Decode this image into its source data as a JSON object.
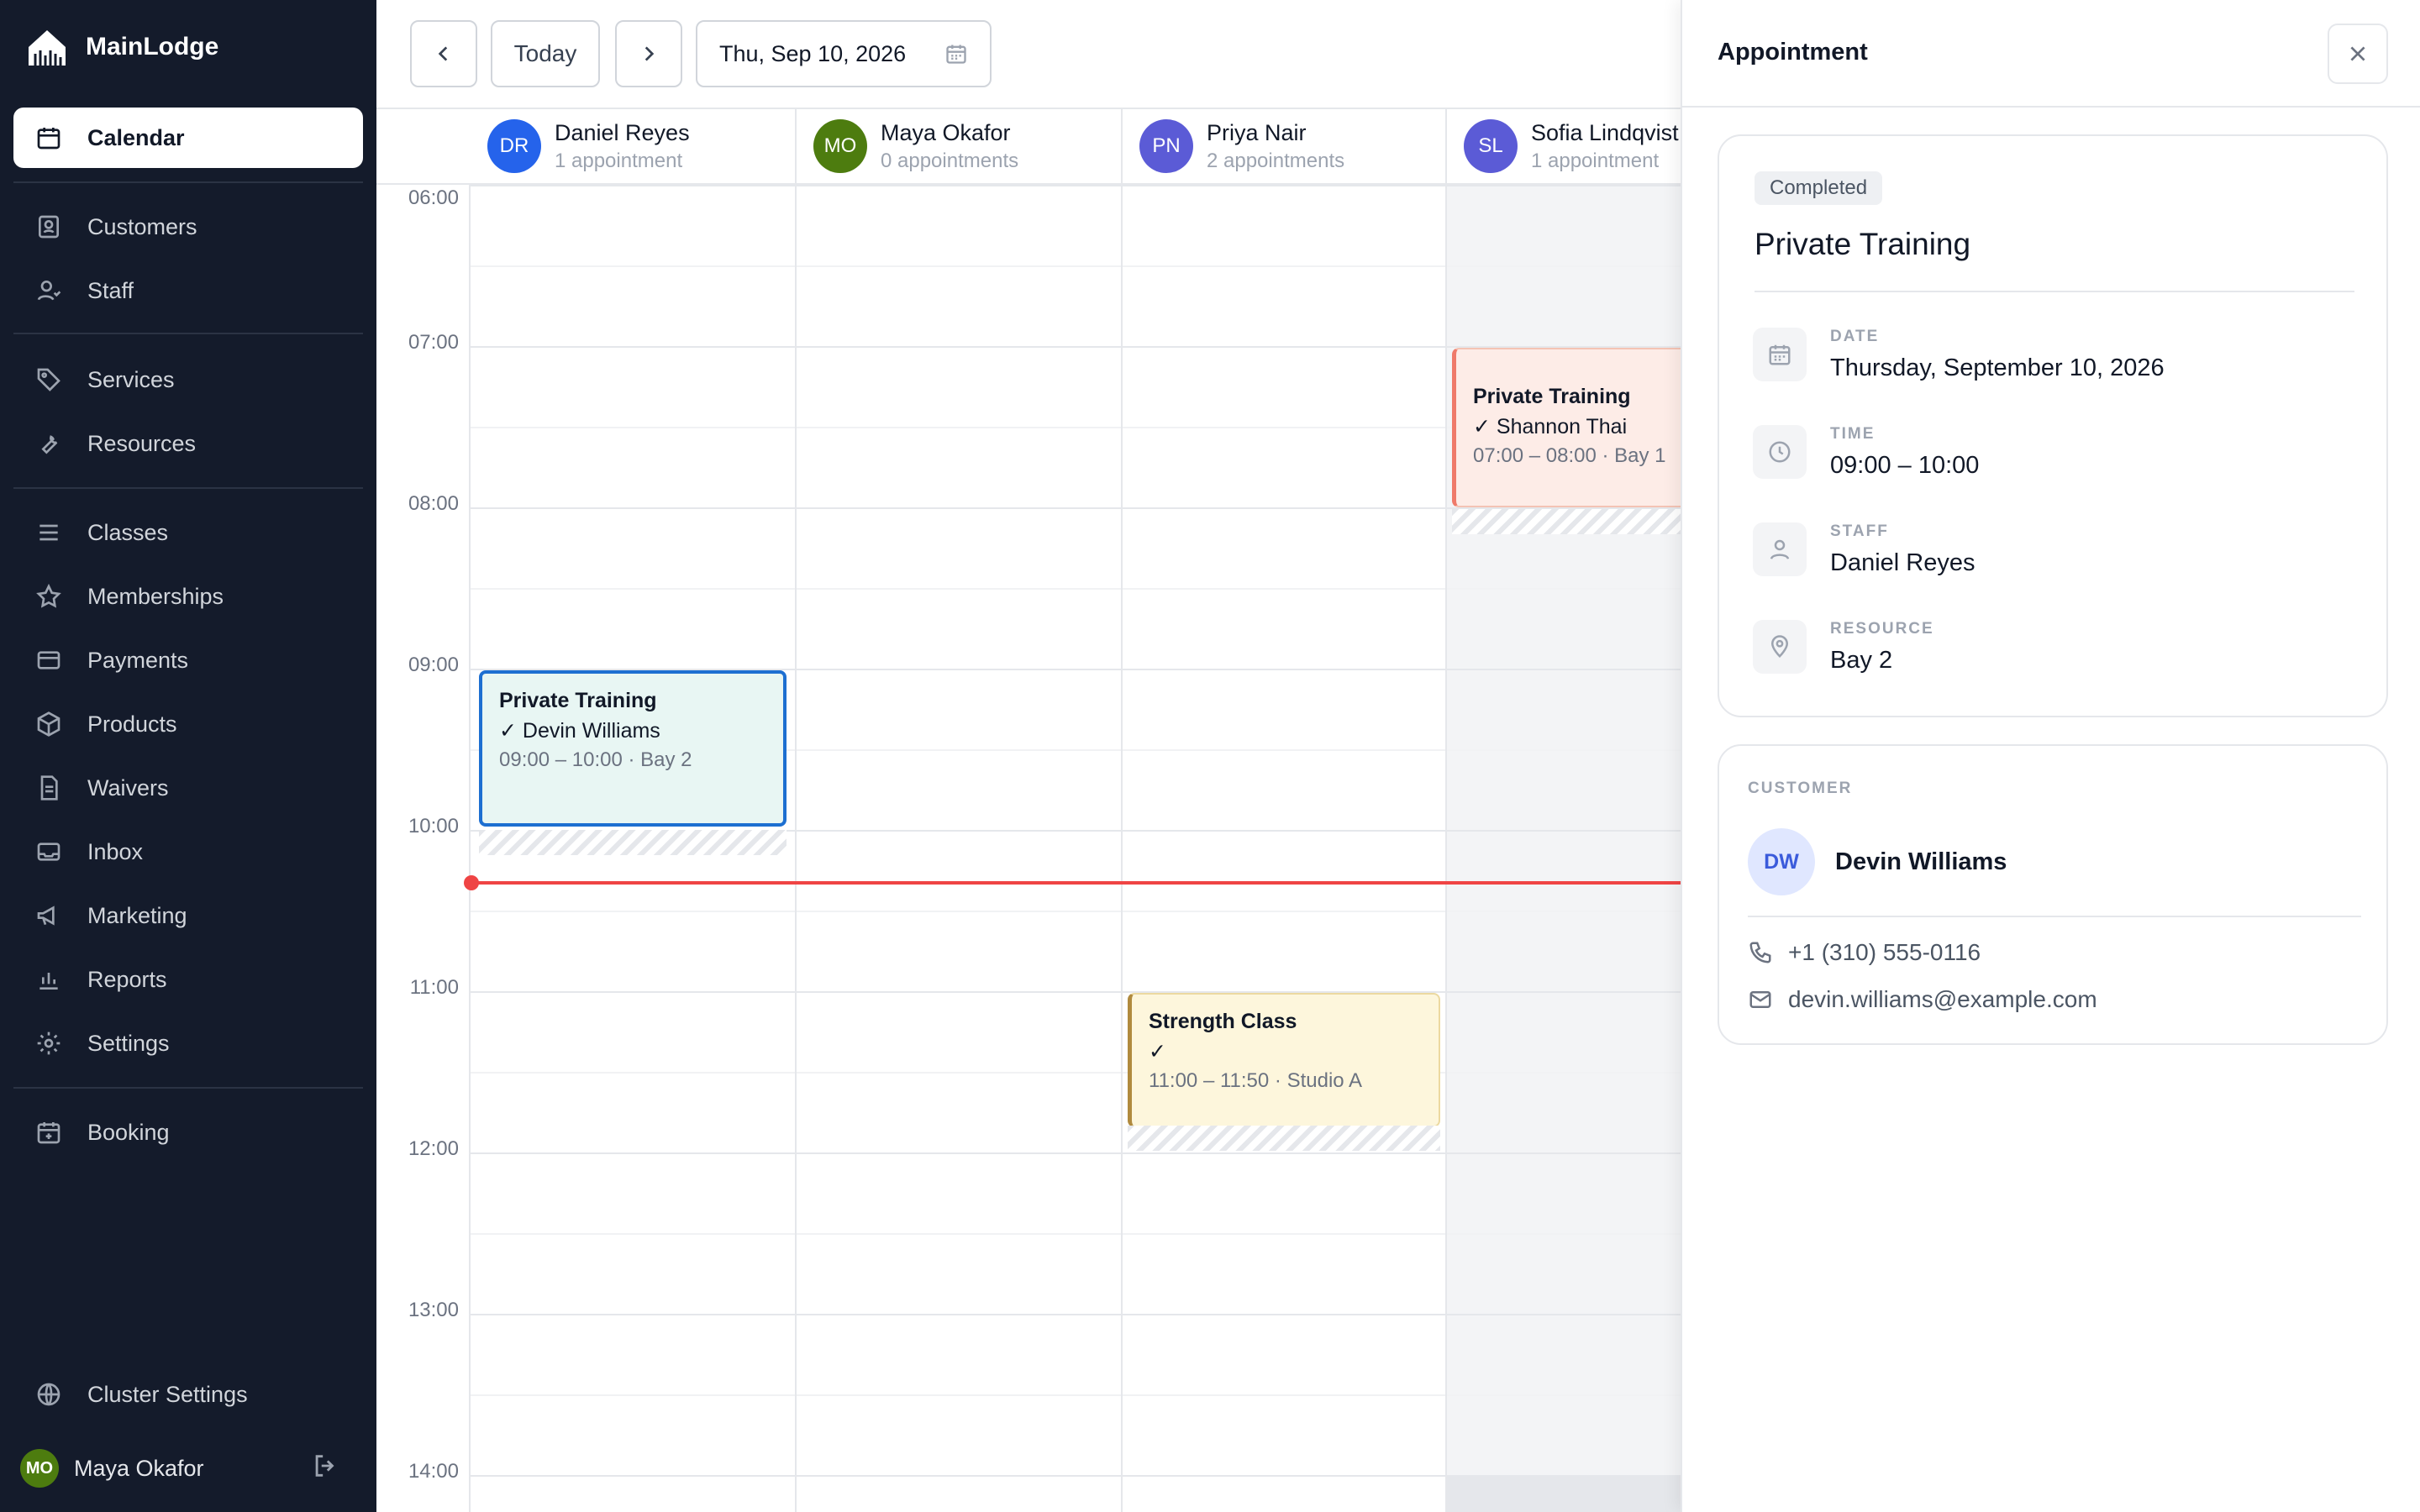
{
  "app": {
    "name": "MainLodge"
  },
  "sidebar": {
    "items": [
      {
        "label": "Calendar",
        "icon": "calendar-icon"
      },
      {
        "label": "Customers",
        "icon": "customers-icon"
      },
      {
        "label": "Staff",
        "icon": "staff-icon"
      },
      {
        "label": "Services",
        "icon": "tag-icon"
      },
      {
        "label": "Resources",
        "icon": "wrench-icon"
      },
      {
        "label": "Classes",
        "icon": "list-icon"
      },
      {
        "label": "Memberships",
        "icon": "star-icon"
      },
      {
        "label": "Payments",
        "icon": "card-icon"
      },
      {
        "label": "Products",
        "icon": "box-icon"
      },
      {
        "label": "Waivers",
        "icon": "document-icon"
      },
      {
        "label": "Inbox",
        "icon": "inbox-icon"
      },
      {
        "label": "Marketing",
        "icon": "megaphone-icon"
      },
      {
        "label": "Reports",
        "icon": "bar-chart-icon"
      },
      {
        "label": "Settings",
        "icon": "gear-icon"
      },
      {
        "label": "Booking",
        "icon": "calendar-plus-icon"
      },
      {
        "label": "Cluster Settings",
        "icon": "globe-icon"
      }
    ],
    "user": {
      "initials": "MO",
      "name": "Maya Okafor"
    }
  },
  "toolbar": {
    "today": "Today",
    "date": "Thu, Sep 10, 2026"
  },
  "calendar": {
    "staff": [
      {
        "initials": "DR",
        "name": "Daniel Reyes",
        "count": "1 appointment",
        "color": "#2563eb"
      },
      {
        "initials": "MO",
        "name": "Maya Okafor",
        "count": "0 appointments",
        "color": "#4d7c0f"
      },
      {
        "initials": "PN",
        "name": "Priya Nair",
        "count": "2 appointments",
        "color": "#5b5bd6"
      },
      {
        "initials": "SL",
        "name": "Sofia Lindqvist",
        "count": "1 appointment",
        "color": "#5b5bd6"
      }
    ],
    "hours": [
      "06:00",
      "07:00",
      "08:00",
      "09:00",
      "10:00",
      "11:00",
      "12:00",
      "13:00",
      "14:00"
    ],
    "appointments": [
      {
        "title": "Private Training",
        "customer": "Devin Williams",
        "meta": "09:00 – 10:00 · Bay 2"
      },
      {
        "title": "Private Training",
        "customer": "Shannon Thai",
        "meta": "07:00 – 08:00 · Bay 1"
      },
      {
        "title": "Strength Class",
        "customer": "",
        "meta": "11:00 – 11:50 · Studio A"
      }
    ]
  },
  "panel": {
    "title": "Appointment",
    "status": "Completed",
    "service": "Private Training",
    "details": [
      {
        "label": "DATE",
        "value": "Thursday, September 10, 2026",
        "icon": "calendar-icon"
      },
      {
        "label": "TIME",
        "value": "09:00 – 10:00",
        "icon": "clock-icon"
      },
      {
        "label": "STAFF",
        "value": "Daniel Reyes",
        "icon": "person-icon"
      },
      {
        "label": "RESOURCE",
        "value": "Bay 2",
        "icon": "pin-icon"
      }
    ],
    "customer": {
      "heading": "CUSTOMER",
      "initials": "DW",
      "name": "Devin Williams",
      "phone": "+1 (310) 555-0116",
      "email": "devin.williams@example.com"
    }
  }
}
